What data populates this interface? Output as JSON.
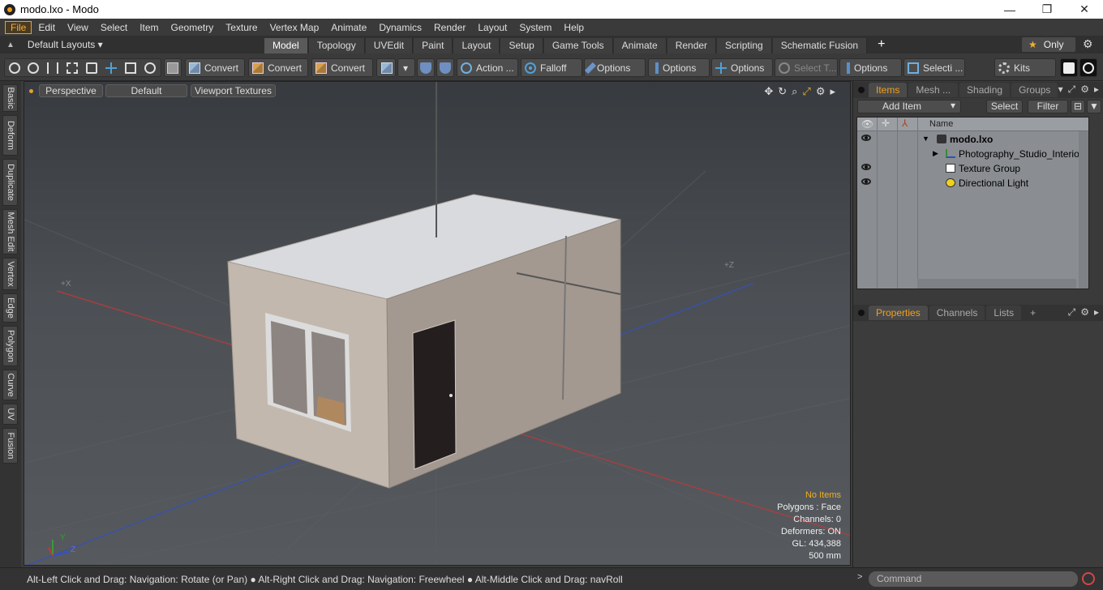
{
  "window": {
    "title": "modo.lxo - Modo",
    "minimize": "—",
    "maximize": "❐",
    "close": "✕"
  },
  "menu": [
    "File",
    "Edit",
    "View",
    "Select",
    "Item",
    "Geometry",
    "Texture",
    "Vertex Map",
    "Animate",
    "Dynamics",
    "Render",
    "Layout",
    "System",
    "Help"
  ],
  "layout_selector": {
    "label": "Default Layouts ▾"
  },
  "layout_tabs": [
    "Model",
    "Topology",
    "UVEdit",
    "Paint",
    "Layout",
    "Setup",
    "Game Tools",
    "Animate",
    "Render",
    "Scripting",
    "Schematic Fusion"
  ],
  "layout_tabs_active": "Model",
  "only_button": "Only",
  "toolbar": {
    "convert1": "Convert",
    "convert2": "Convert",
    "convert3": "Convert",
    "action": "Action ...",
    "falloff": "Falloff",
    "options1": "Options",
    "options2": "Options",
    "options3": "Options",
    "select_t": "Select T...",
    "options4": "Options",
    "selecti": "Selecti ...",
    "kits": "Kits"
  },
  "left_tabs": [
    "Basic",
    "Deform",
    "Duplicate",
    "Mesh Edit",
    "Vertex",
    "Edge",
    "Polygon",
    "Curve",
    "UV",
    "Fusion"
  ],
  "viewport": {
    "view": "Perspective",
    "shading": "Default",
    "textures": "Viewport Textures",
    "axis_x": "+X",
    "axis_z": "+Z",
    "gizmo_y": "Y",
    "gizmo_z": "Z",
    "stats": {
      "no_items": "No Items",
      "polygons": "Polygons : Face",
      "channels": "Channels: 0",
      "deformers": "Deformers: ON",
      "gl": "GL: 434,388",
      "scale": "500 mm"
    }
  },
  "status": {
    "message": "Alt-Left Click and Drag: Navigation: Rotate (or Pan) ● Alt-Right Click and Drag: Navigation: Freewheel ● Alt-Middle Click and Drag: navRoll",
    "command_placeholder": "Command"
  },
  "items_panel": {
    "tabs": [
      "Items",
      "Mesh ...",
      "Shading",
      "Groups"
    ],
    "active_tab": "Items",
    "add_item": "Add Item",
    "select": "Select",
    "filter": "Filter",
    "column_name": "Name",
    "tree": [
      {
        "name": "modo.lxo",
        "bold": true,
        "visible": true
      },
      {
        "name": "Photography_Studio_Interior",
        "bold": false,
        "visible": false
      },
      {
        "name": "Texture Group",
        "bold": false,
        "visible": true
      },
      {
        "name": "Directional Light",
        "bold": false,
        "visible": true
      }
    ]
  },
  "properties_panel": {
    "tabs": [
      "Properties",
      "Channels",
      "Lists"
    ],
    "active_tab": "Properties"
  },
  "colors": {
    "accent": "#f0a020",
    "background": "#3c3c3c",
    "viewport_top": "#373b40"
  }
}
